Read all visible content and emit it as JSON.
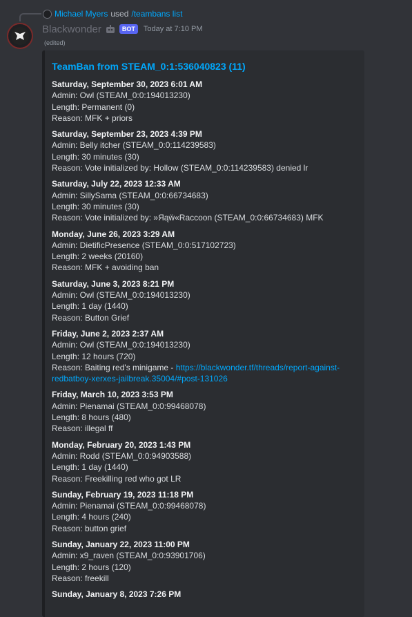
{
  "reply": {
    "user": "Michael Myers",
    "used_text": "used",
    "command": "/teambans list"
  },
  "message": {
    "username": "Blackwonder",
    "bot_tag": "BOT",
    "timestamp": "Today at 7:10 PM",
    "edited": "(edited)"
  },
  "embed": {
    "title": "TeamBan from STEAM_0:1:536040823 (11)",
    "entries": [
      {
        "date": "Saturday, September 30, 2023 6:01 AM",
        "admin": "Admin: Owl (STEAM_0:0:194013230)",
        "length": "Length: Permanent (0)",
        "reason": "Reason: MFK + priors"
      },
      {
        "date": "Saturday, September 23, 2023 4:39 PM",
        "admin": "Admin: Belly itcher (STEAM_0:0:114239583)",
        "length": "Length: 30 minutes (30)",
        "reason": "Reason: Vote initialized by: Hollow (STEAM_0:0:114239583) denied lr"
      },
      {
        "date": "Saturday, July 22, 2023 12:33 AM",
        "admin": "Admin: SillySama (STEAM_0:0:66734683)",
        "length": "Length: 30 minutes (30)",
        "reason": "Reason: Vote initialized by: »Яąẅ«Raccoon (STEAM_0:0:66734683) MFK"
      },
      {
        "date": "Monday, June 26, 2023 3:29 AM",
        "admin": "Admin: DietificPresence (STEAM_0:0:517102723)",
        "length": "Length: 2 weeks (20160)",
        "reason": "Reason: MFK + avoiding ban"
      },
      {
        "date": "Saturday, June 3, 2023 8:21 PM",
        "admin": "Admin: Owl (STEAM_0:0:194013230)",
        "length": "Length: 1 day (1440)",
        "reason": "Reason: Button Grief"
      },
      {
        "date": "Friday, June 2, 2023 2:37 AM",
        "admin": "Admin: Owl (STEAM_0:0:194013230)",
        "length": "Length: 12 hours (720)",
        "reason": "Reason: Baiting red's minigame - ",
        "reason_link_1": "https://blackwonder.tf/threads/report-against-",
        "reason_link_2": "redbatboy-xerxes-jailbreak.35004/#post-131026"
      },
      {
        "date": "Friday, March 10, 2023 3:53 PM",
        "admin": "Admin: Pienamai (STEAM_0:0:99468078)",
        "length": "Length: 8 hours (480)",
        "reason": "Reason: illegal ff"
      },
      {
        "date": "Monday, February 20, 2023 1:43 PM",
        "admin": "Admin: Rodd (STEAM_0:0:94903588)",
        "length": "Length: 1 day (1440)",
        "reason": "Reason: Freekilling red who got LR"
      },
      {
        "date": "Sunday, February 19, 2023 11:18 PM",
        "admin": "Admin: Pienamai (STEAM_0:0:99468078)",
        "length": "Length: 4 hours (240)",
        "reason": "Reason: button grief"
      },
      {
        "date": "Sunday, January 22, 2023 11:00 PM",
        "admin": "Admin: x9_raven (STEAM_0:0:93901706)",
        "length": "Length: 2 hours (120)",
        "reason": "Reason: freekill"
      },
      {
        "date": "Sunday, January 8, 2023 7:26 PM"
      }
    ]
  }
}
